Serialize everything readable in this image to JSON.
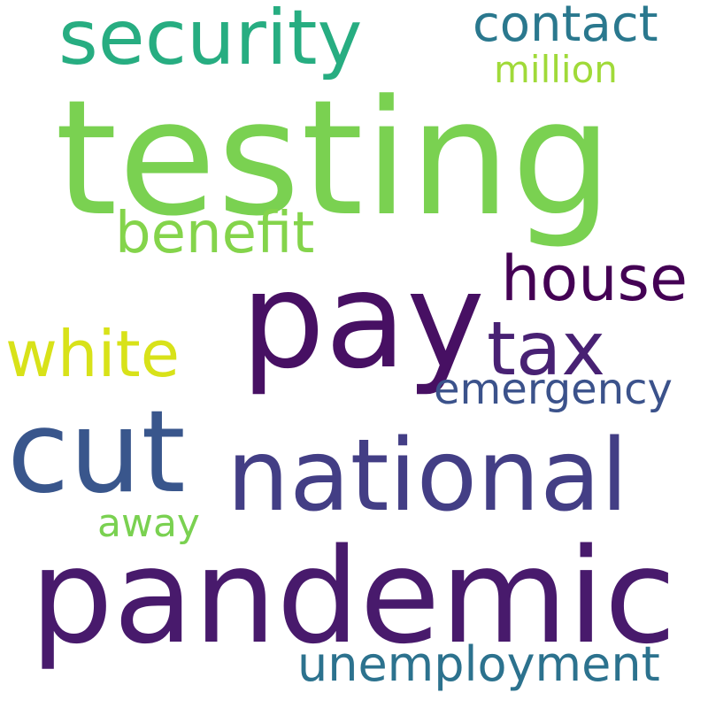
{
  "words": {
    "testing": {
      "text": "testing",
      "color": "#7ad151"
    },
    "pandemic": {
      "text": "pandemic",
      "color": "#481a6c"
    },
    "pay": {
      "text": "pay",
      "color": "#471063"
    },
    "cut": {
      "text": "cut",
      "color": "#39568c"
    },
    "national": {
      "text": "national",
      "color": "#433e85"
    },
    "security": {
      "text": "security",
      "color": "#27ad81"
    },
    "benefit": {
      "text": "benefit",
      "color": "#84d44b"
    },
    "white": {
      "text": "white",
      "color": "#d8e219"
    },
    "house": {
      "text": "house",
      "color": "#440154"
    },
    "tax": {
      "text": "tax",
      "color": "#482173"
    },
    "contact": {
      "text": "contact",
      "color": "#2a788e"
    },
    "million": {
      "text": "million",
      "color": "#a0da39"
    },
    "emergency": {
      "text": "emergency",
      "color": "#3b528b"
    },
    "unemployment": {
      "text": "unemployment",
      "color": "#2c728e"
    },
    "away": {
      "text": "away",
      "color": "#7ad151"
    }
  }
}
